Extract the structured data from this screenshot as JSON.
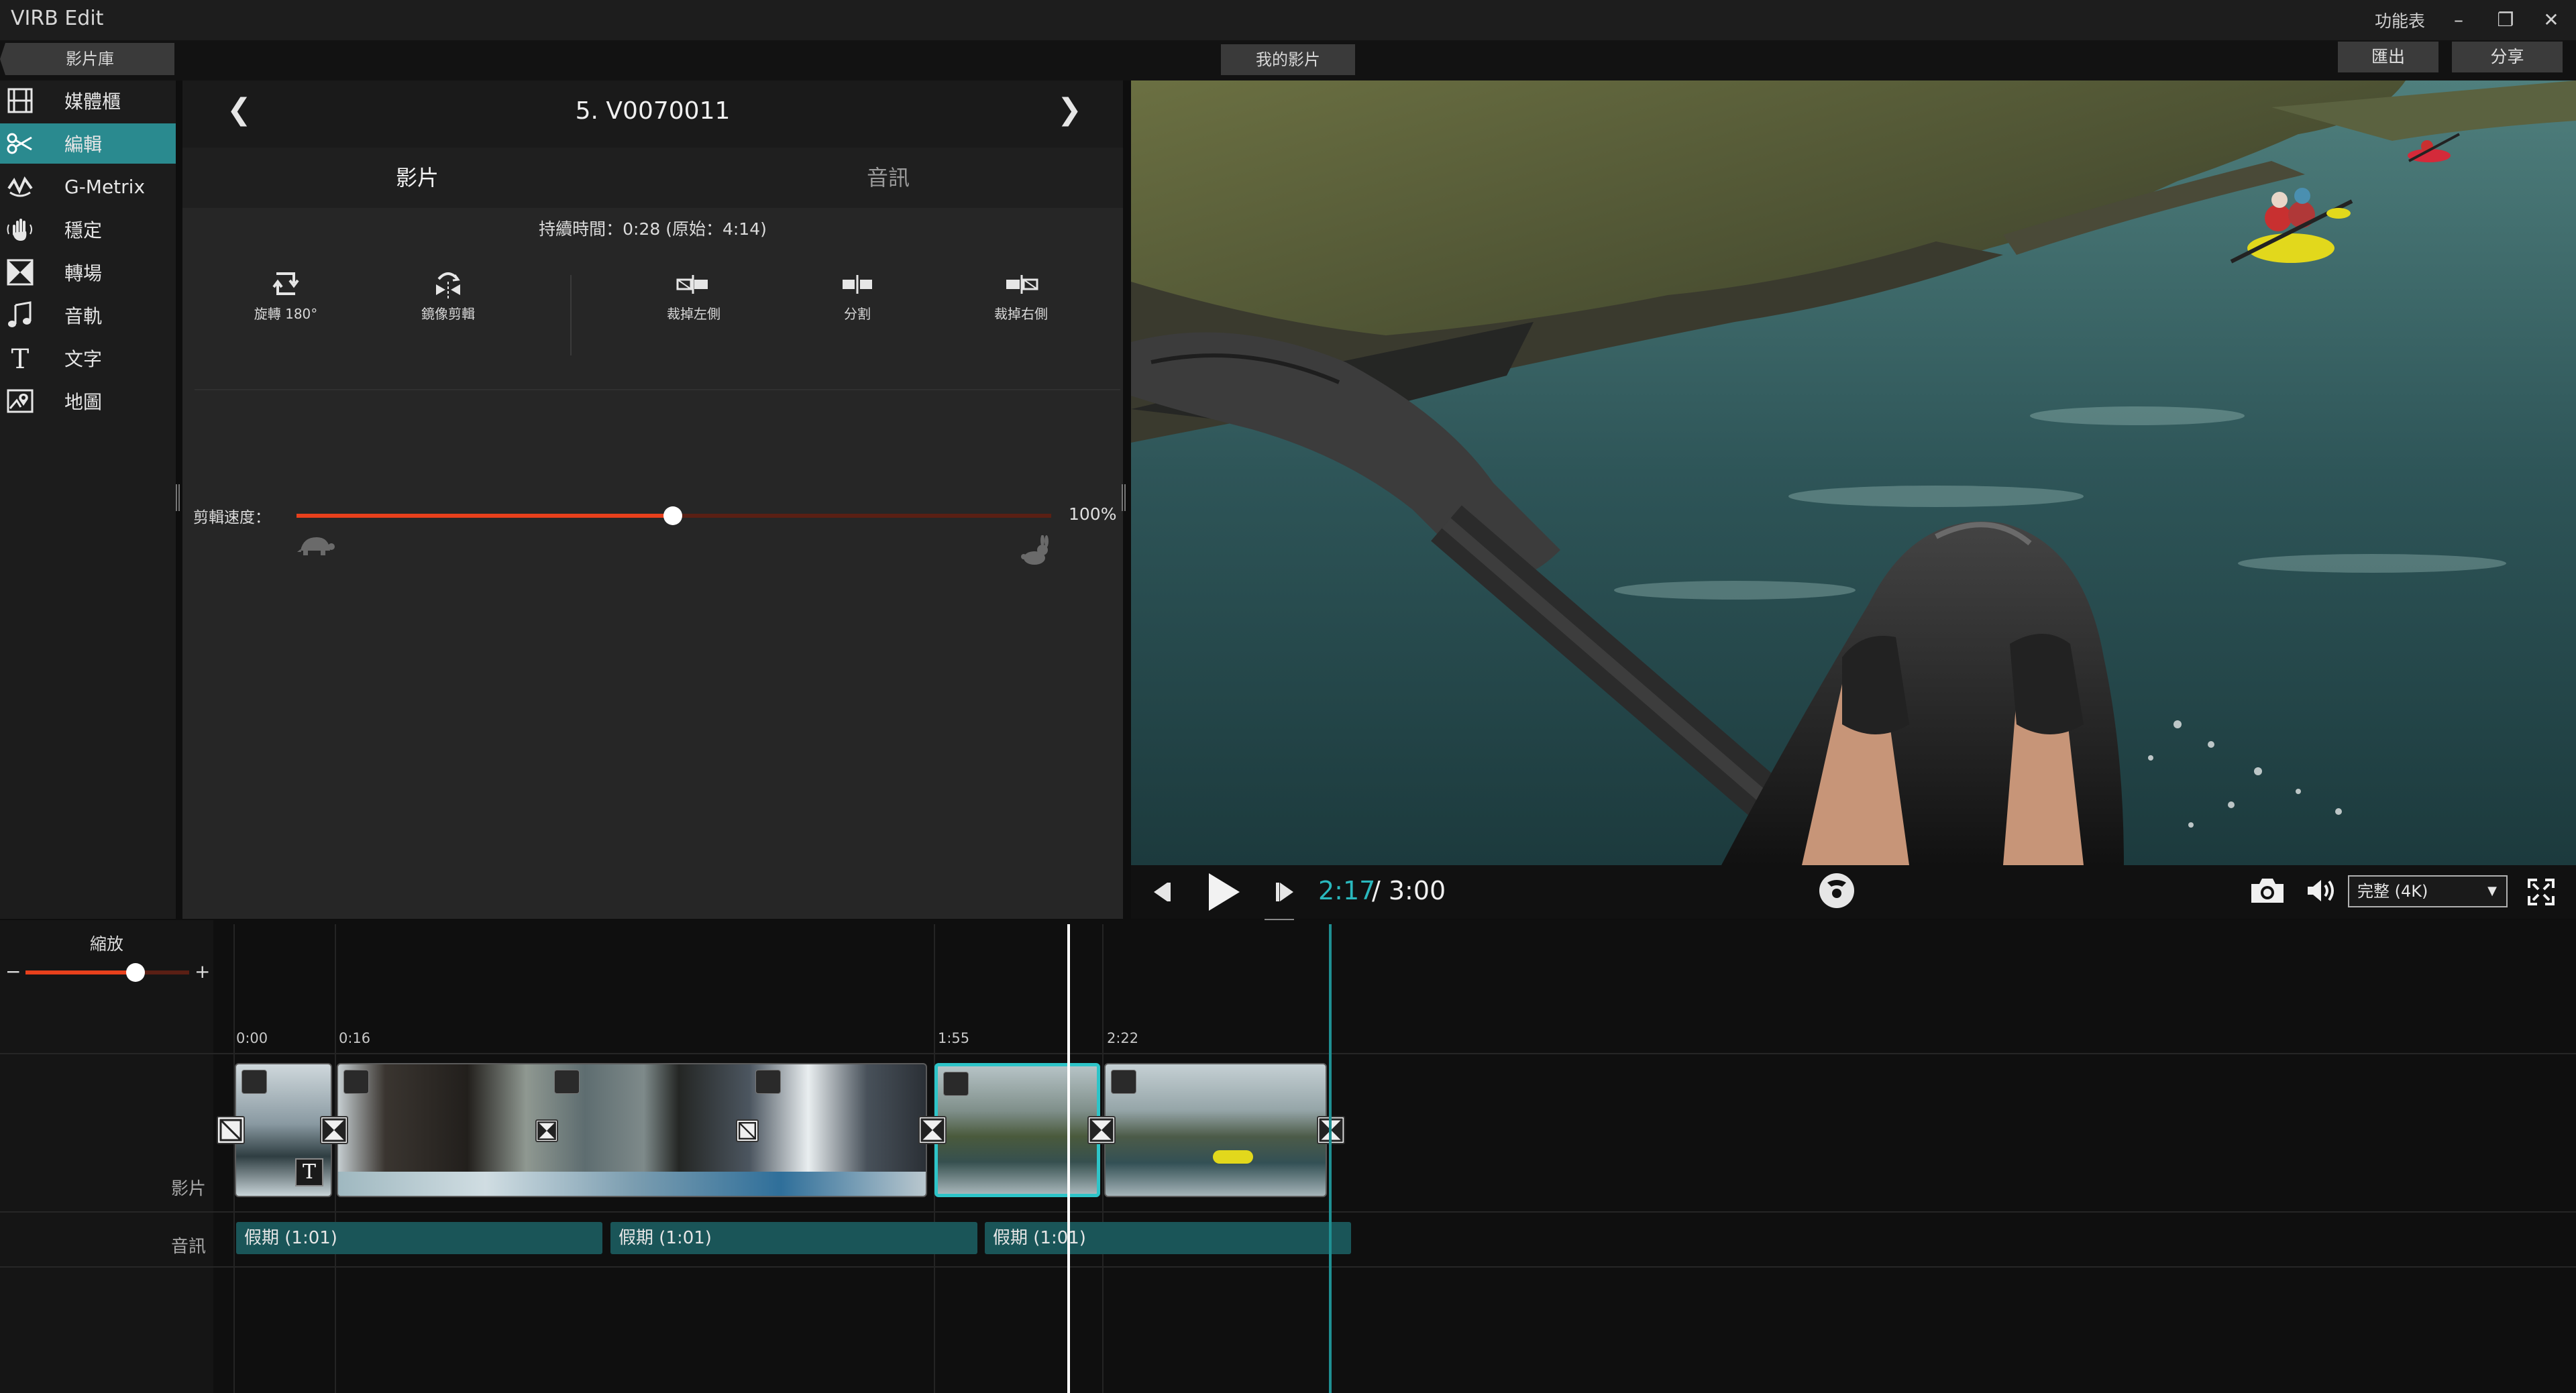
{
  "window": {
    "app_title": "VIRB Edit",
    "menu_label": "功能表",
    "minimize_glyph": "–",
    "restore_glyph": "❐",
    "close_glyph": "✕"
  },
  "topbar": {
    "library_tab": "影片庫",
    "my_movie_tab": "我的影片",
    "export_label": "匯出",
    "share_label": "分享"
  },
  "sidebar": {
    "items": [
      {
        "label": "媒體櫃",
        "icon": "film-icon",
        "active": false
      },
      {
        "label": "編輯",
        "icon": "scissors-icon",
        "active": true
      },
      {
        "label": "G-Metrix",
        "icon": "gmetrix-icon",
        "active": false
      },
      {
        "label": "穩定",
        "icon": "stabilize-hand-icon",
        "active": false
      },
      {
        "label": "轉場",
        "icon": "transition-icon",
        "active": false
      },
      {
        "label": "音軌",
        "icon": "music-note-icon",
        "active": false
      },
      {
        "label": "文字",
        "icon": "text-icon",
        "active": false
      },
      {
        "label": "地圖",
        "icon": "map-icon",
        "active": false
      }
    ]
  },
  "edit_panel": {
    "clip_title": "5. V0070011",
    "prev_glyph": "❮",
    "next_glyph": "❯",
    "tabs": [
      {
        "label": "影片",
        "active": true
      },
      {
        "label": "音訊",
        "active": false
      }
    ],
    "duration_text": "持續時間：0:28 (原始：4:14)",
    "tools": [
      {
        "label": "旋轉 180°",
        "icon": "rotate-icon"
      },
      {
        "label": "鏡像剪輯",
        "icon": "mirror-icon"
      },
      {
        "label": "裁掉左側",
        "icon": "trim-left-icon"
      },
      {
        "label": "分割",
        "icon": "split-icon"
      },
      {
        "label": "裁掉右側",
        "icon": "trim-right-icon"
      }
    ],
    "speed": {
      "label": "剪輯速度：",
      "value_text": "100%",
      "level": 0.5
    }
  },
  "player": {
    "current_time": "2:17",
    "total_time": "/ 3:00",
    "quality": "完整 (4K)",
    "progress": 0.761
  },
  "timeline": {
    "zoom_label": "縮放",
    "zoom_minus": "−",
    "zoom_plus": "+",
    "zoom_level": 0.67,
    "ticks": [
      "0:00",
      "0:16",
      "1:55",
      "2:22"
    ],
    "video_track_label": "影片",
    "audio_track_label": "音訊",
    "text_badge": "T",
    "audio_clips": [
      {
        "label": "假期  (1:01)"
      },
      {
        "label": "假期  (1:01)"
      },
      {
        "label": "假期  (1:01)"
      }
    ]
  },
  "colors": {
    "accent_teal": "#2a8a8f",
    "accent_orange": "#e8401c",
    "selected_clip_border": "#2ec4c8",
    "audio_clip": "#1a5558"
  }
}
